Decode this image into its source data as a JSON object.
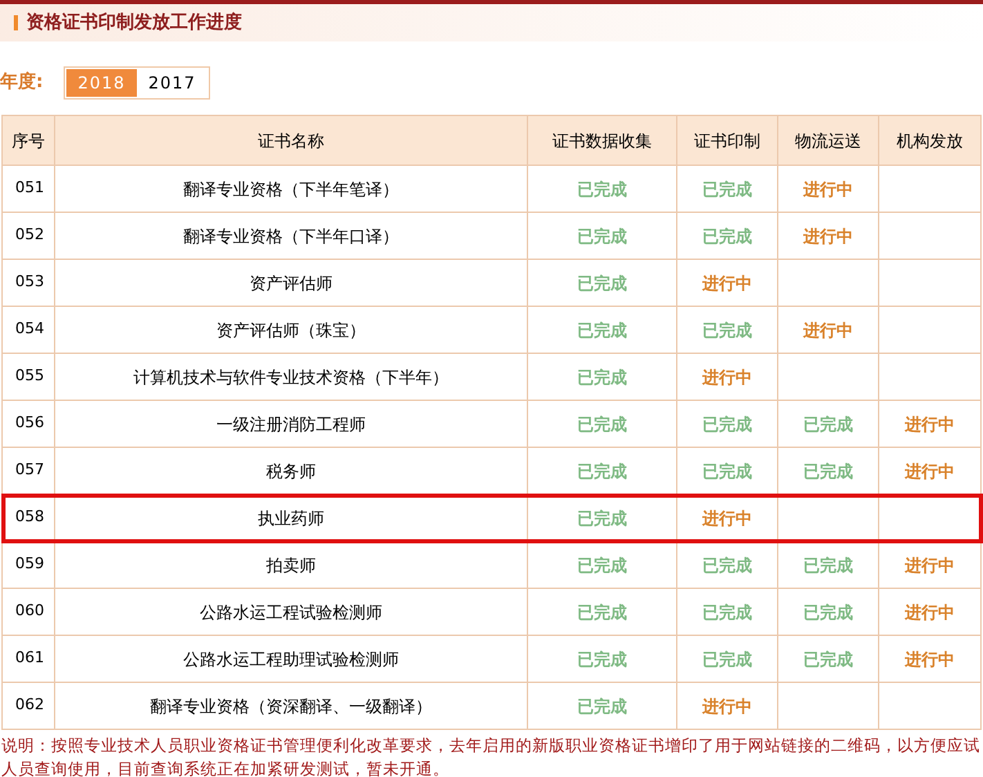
{
  "title": "资格证书印制发放工作进度",
  "year_label": "年度:",
  "years": [
    {
      "label": "2018",
      "selected": true
    },
    {
      "label": "2017",
      "selected": false
    }
  ],
  "table": {
    "columns": [
      "序号",
      "证书名称",
      "证书数据收集",
      "证书印制",
      "物流运送",
      "机构发放"
    ],
    "rows": [
      {
        "no": "051",
        "name": "翻译专业资格（下半年笔译）",
        "highlighted": false,
        "stages": [
          {
            "text": "已完成",
            "kind": "done"
          },
          {
            "text": "已完成",
            "kind": "done"
          },
          {
            "text": "进行中",
            "kind": "progress"
          }
        ]
      },
      {
        "no": "052",
        "name": "翻译专业资格（下半年口译）",
        "highlighted": false,
        "stages": [
          {
            "text": "已完成",
            "kind": "done"
          },
          {
            "text": "已完成",
            "kind": "done"
          },
          {
            "text": "进行中",
            "kind": "progress"
          }
        ]
      },
      {
        "no": "053",
        "name": "资产评估师",
        "highlighted": false,
        "stages": [
          {
            "text": "已完成",
            "kind": "done"
          },
          {
            "text": "进行中",
            "kind": "progress"
          }
        ]
      },
      {
        "no": "054",
        "name": "资产评估师（珠宝）",
        "highlighted": false,
        "stages": [
          {
            "text": "已完成",
            "kind": "done"
          },
          {
            "text": "已完成",
            "kind": "done"
          },
          {
            "text": "进行中",
            "kind": "progress"
          }
        ]
      },
      {
        "no": "055",
        "name": "计算机技术与软件专业技术资格（下半年）",
        "highlighted": false,
        "stages": [
          {
            "text": "已完成",
            "kind": "done"
          },
          {
            "text": "进行中",
            "kind": "progress"
          }
        ]
      },
      {
        "no": "056",
        "name": "一级注册消防工程师",
        "highlighted": false,
        "stages": [
          {
            "text": "已完成",
            "kind": "done"
          },
          {
            "text": "已完成",
            "kind": "done"
          },
          {
            "text": "已完成",
            "kind": "done"
          },
          {
            "text": "进行中",
            "kind": "progress"
          }
        ]
      },
      {
        "no": "057",
        "name": "税务师",
        "highlighted": false,
        "stages": [
          {
            "text": "已完成",
            "kind": "done"
          },
          {
            "text": "已完成",
            "kind": "done"
          },
          {
            "text": "已完成",
            "kind": "done"
          },
          {
            "text": "进行中",
            "kind": "progress"
          }
        ]
      },
      {
        "no": "058",
        "name": "执业药师",
        "highlighted": true,
        "stages": [
          {
            "text": "已完成",
            "kind": "done"
          },
          {
            "text": "进行中",
            "kind": "progress"
          }
        ]
      },
      {
        "no": "059",
        "name": "拍卖师",
        "highlighted": false,
        "stages": [
          {
            "text": "已完成",
            "kind": "done"
          },
          {
            "text": "已完成",
            "kind": "done"
          },
          {
            "text": "已完成",
            "kind": "done"
          },
          {
            "text": "进行中",
            "kind": "progress"
          }
        ]
      },
      {
        "no": "060",
        "name": "公路水运工程试验检测师",
        "highlighted": false,
        "stages": [
          {
            "text": "已完成",
            "kind": "done"
          },
          {
            "text": "已完成",
            "kind": "done"
          },
          {
            "text": "已完成",
            "kind": "done"
          },
          {
            "text": "进行中",
            "kind": "progress"
          }
        ]
      },
      {
        "no": "061",
        "name": "公路水运工程助理试验检测师",
        "highlighted": false,
        "stages": [
          {
            "text": "已完成",
            "kind": "done"
          },
          {
            "text": "已完成",
            "kind": "done"
          },
          {
            "text": "已完成",
            "kind": "done"
          },
          {
            "text": "进行中",
            "kind": "progress"
          }
        ]
      },
      {
        "no": "062",
        "name": "翻译专业资格（资深翻译、一级翻译）",
        "highlighted": false,
        "stages": [
          {
            "text": "已完成",
            "kind": "done"
          },
          {
            "text": "进行中",
            "kind": "progress"
          }
        ]
      }
    ]
  },
  "note": "说明：按照专业技术人员职业资格证书管理便利化改革要求，去年启用的新版职业资格证书增印了用于网站链接的二维码，以方便应试人员查询使用，目前查询系统正在加紧研发测试，暂未开通。"
}
